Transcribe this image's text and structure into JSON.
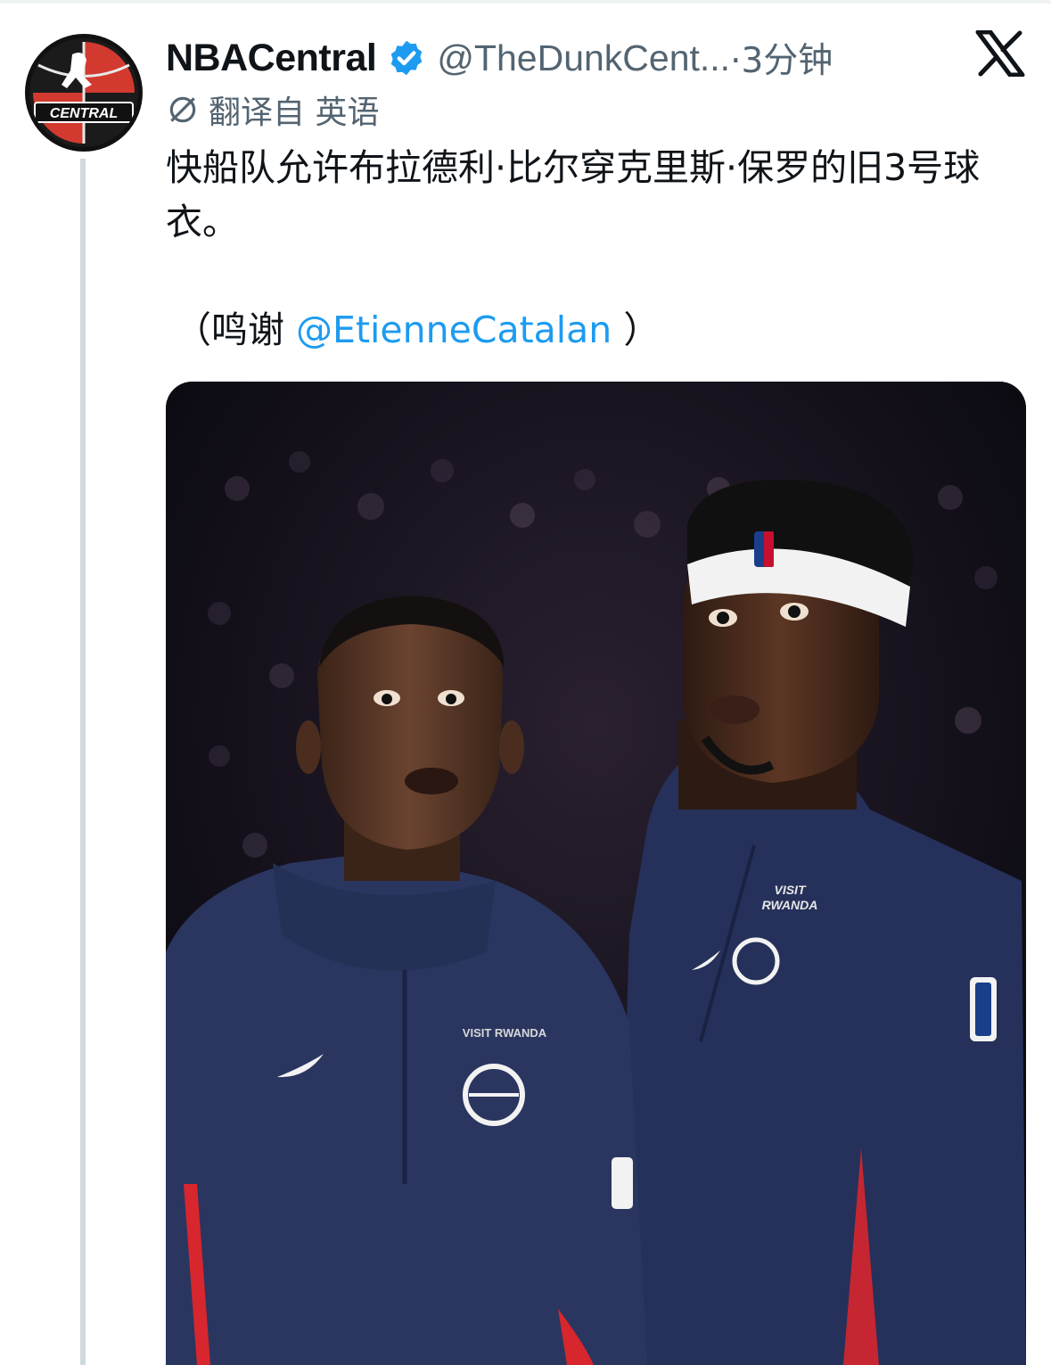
{
  "tweet": {
    "display_name": "NBACentral",
    "handle": "@TheDunkCent...",
    "timestamp": "·3分钟",
    "translated_label": "翻译自 英语",
    "text": "快船队允许布拉德利·比尔穿克里斯·保罗的旧3号球衣。",
    "credit_open": "（鸣谢 ",
    "credit_mention": "@EtienneCatalan",
    "credit_close": " ）"
  },
  "avatar": {
    "logo_text": "CENTRAL"
  },
  "photo": {
    "left_player": {
      "chest_text": "VISIT RWANDA"
    },
    "right_player": {
      "chest_text_line1": "VISIT",
      "chest_text_line2": "RWANDA"
    }
  },
  "colors": {
    "accent": "#1d9bf0",
    "muted": "#536471",
    "jersey_navy": "#2a3660",
    "stripe_red": "#d7262d"
  },
  "icons": [
    "verified-badge-icon",
    "x-logo-icon",
    "translate-icon",
    "nike-swoosh-icon",
    "nba-logo-icon"
  ]
}
